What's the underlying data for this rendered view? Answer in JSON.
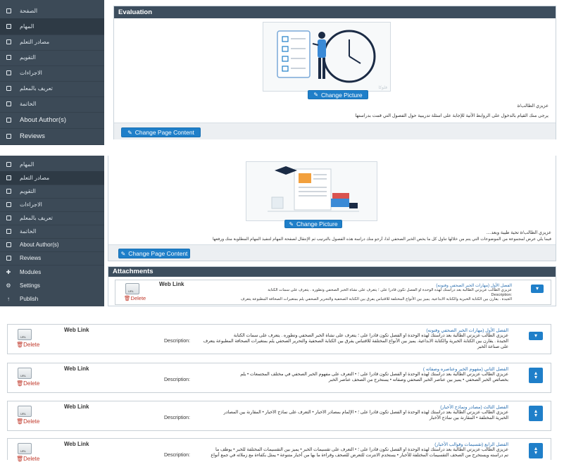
{
  "section1": {
    "sidebar": [
      {
        "label": "الصفحة",
        "icon": "doc-icon"
      },
      {
        "label": "المهام",
        "icon": "doc-icon"
      },
      {
        "label": "مصادر التعلم",
        "icon": "doc-icon"
      },
      {
        "label": "التقويم",
        "icon": "doc-icon"
      },
      {
        "label": "الاجراءات",
        "icon": "doc-icon"
      },
      {
        "label": "تعريف بالمعلم",
        "icon": "doc-icon"
      },
      {
        "label": "الخاتمة",
        "icon": "doc-icon"
      },
      {
        "label": "About Author(s)",
        "icon": "doc-icon"
      },
      {
        "label": "Reviews",
        "icon": "doc-icon"
      }
    ],
    "panel_title": "Evaluation",
    "change_picture": "Change Picture",
    "greeting": "عزيزي الطالب/ة",
    "instruction": "يرجى منك القيام بالدخول على الروابط الآتية للإجابة على اسئلة تدريبية حول الفصول التي قمت بدراستها",
    "change_page_content": "Change Page Content",
    "watermark": "فلوكا"
  },
  "section2": {
    "sidebar": [
      {
        "label": "المهام",
        "icon": "doc-icon"
      },
      {
        "label": "مصادر التعلم",
        "icon": "doc-icon"
      },
      {
        "label": "التقويم",
        "icon": "doc-icon"
      },
      {
        "label": "الاجراءات",
        "icon": "doc-icon"
      },
      {
        "label": "تعريف بالمعلم",
        "icon": "doc-icon"
      },
      {
        "label": "الخاتمة",
        "icon": "doc-icon"
      },
      {
        "label": "About Author(s)",
        "icon": "doc-icon"
      },
      {
        "label": "Reviews",
        "icon": "doc-icon"
      },
      {
        "label": "Modules",
        "icon": "plus-icon"
      },
      {
        "label": "Settings",
        "icon": "gear-icon"
      },
      {
        "label": "Publish",
        "icon": "arrow-icon"
      }
    ],
    "change_picture": "Change Picture",
    "greeting": "عزيزي الطالب/ة تحية طيبة وبعد....",
    "paragraph": "فيما يلي عرض لمجموعة من الموضوعات التي يتم من خلالها تناول كل ما يخص الخبر الصحفي لذا، أرجو منك دراسة هذه الفصول بالترتيب ثم الإنتقال لصفحة المهام لتنفيذ المهام المطلوبة منك ورفعها",
    "change_page_content": "Change Page Content",
    "attachments_title": "Attachments",
    "attachment": {
      "title": "Web Link",
      "link": "الفصل الأول (مهارات الخبر الصحفي وفنونه)",
      "desc1": "عزيزي الطالب عزيزتي الطالبة بعد دراستك لهذه الوحدة او الفصل تكون قادراً على ؛ يتعرف على نشأة الخبر الصحفي وتطوره . يتعرف على سمات الكتابة",
      "desc_en": "Description:",
      "desc2": "الجيدة . يقارن بين الكتابة الخبرية والكتابة الابداعية. يميز بين الأنواع المختلفة للاقتباس يفرق بين الكتابة الصحفية والتحرير الصحفي يلم بمتغيرات الصحافة المطبوعة يتعرف",
      "delete": "Delete",
      "thumb": "URL"
    }
  },
  "section3": {
    "rows": [
      {
        "title": "Web Link",
        "link": "الفصل الأول (مهارات الخبر الصحفي وفنونه)",
        "line1": "عزيزي الطالب عزيزتي الطالبة بعد دراستك لهذه الوحدة او الفصل تكون قادراً على ؛ يتعرف على نشأة الخبر الصحفي وتطوره . يتعرف على سمات الكتابة",
        "desc_en": "Description:",
        "line2": "الجيدة . يقارن بين الكتابة الخبرية والكتابة الابداعية. يميز بين الأنواع المختلفة للاقتباس يفرق بين الكتابة الصحفية والتحرير الصحفي يلم بمتغيرات الصحافة المطبوعة يتعرف",
        "line3": "على صناعة الخبر",
        "delete": "Delete",
        "thumb": "URL",
        "buttons": 1
      },
      {
        "title": "Web Link",
        "link": "الفصل الثاني (مفهوم الخبر وعناصره وصفاته )",
        "line1": "عزيزي الطالب عزيزتي الطالبة بعد دراستك لهذه الوحدة او الفصل تكون قادراً على ؛ • التعرف على مفهوم الخبر الصحفي في مختلف المجتمعات • يلم",
        "desc_en": "Description:",
        "line2": "بخصائص الخبر الصحفي • يميز بين عناصر الخبر الصحفي وصفاته • يستخرج من الصحف عناصر الخبر",
        "line3": "",
        "delete": "Delete",
        "thumb": "URL",
        "buttons": 2
      },
      {
        "title": "Web Link",
        "link": "الفصل الثالث (مصادر ونماذج الأخبار)",
        "line1": "عزيزي الطالب عزيزتي الطالبة بعد دراستك لهذه الوحدة او الفصل تكون قادراً على ؛ • الإلمام بمصادر الأخبار • التعرف على نماذج الأخبار • المقارنة بين المصادر",
        "desc_en": "Description:",
        "line2": "الخبرية المختلفة • المقارنة بين نماذج الأخبار",
        "line3": "",
        "delete": "Delete",
        "thumb": "URL",
        "buttons": 2
      },
      {
        "title": "Web Link",
        "link": "الفصل الرابع (تقسيمات وقوالب الأخبار)",
        "line1": "عزيزي الطالب عزيزتي الطالبة بعد دراستك لهذه الوحدة او الفصل تكون قادراً على ؛ • التعرف على تقسيمات الخبر • يميز بين التقسيمات المختلفة للخبر • يوظف ما",
        "desc_en": "Description:",
        "line2": "تم دراسته ويستخرج من الصحف التقسيمات المختلفة للأخبار • يستخدم الانترنت للتعرض للصحف وقراءة ما بها من أخبار متنوعة • يمثل بكفاءة مع زملائه في جمع أنواع",
        "line3": "",
        "delete": "Delete",
        "thumb": "URL",
        "buttons": 2
      }
    ]
  },
  "colors": {
    "sidebar": "#3c4a57",
    "panel_header": "#3d4e5e",
    "button": "#1f7fc9",
    "delete": "#c0392b",
    "link": "#2a6fb0"
  }
}
